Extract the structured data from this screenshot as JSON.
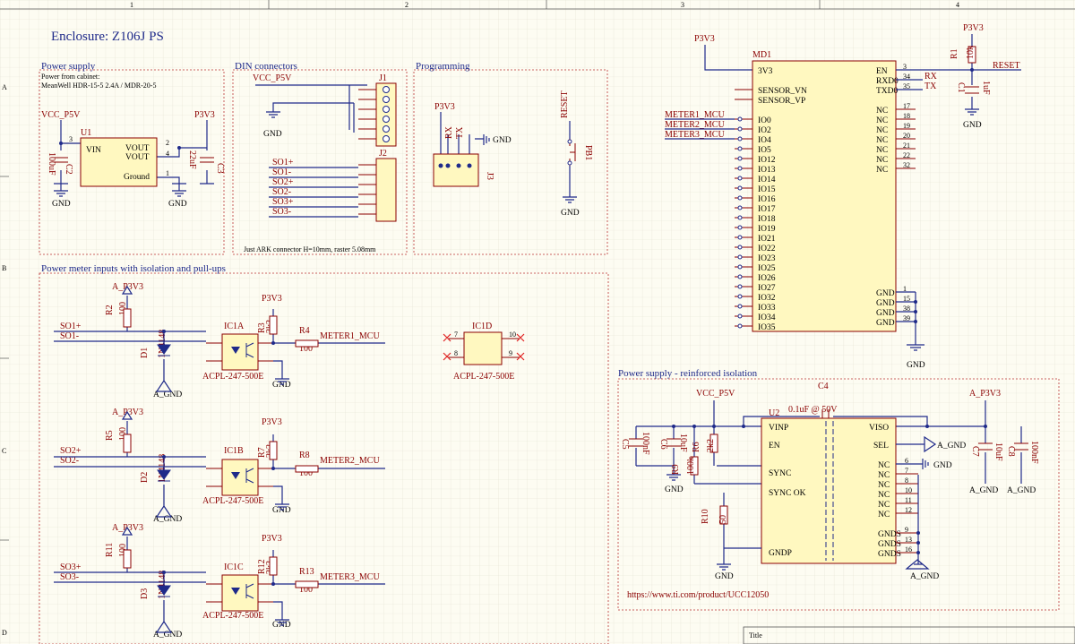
{
  "title": "Enclosure: Z106J PS",
  "grid": {
    "columns": [
      "1",
      "2",
      "3",
      "4"
    ],
    "rows": [
      "A",
      "B",
      "C",
      "D"
    ]
  },
  "sections": {
    "power_supply": "Power supply",
    "power_supply_note1": "Power from cabinet:",
    "power_supply_note2": "MeanWell HDR-15-5 2.4A / MDR-20-5",
    "din": "DIN connectors",
    "din_note": "Just ARK connector H=10mm, raster 5.08mm",
    "programming": "Programming",
    "meter_inputs": "Power meter inputs with isolation and pull-ups",
    "reinforced": "Power supply - reinforced isolation",
    "reinforced_url": "https://www.ti.com/product/UCC12050"
  },
  "nets": {
    "vcc": "VCC_P5V",
    "p3v3": "P3V3",
    "gnd": "GND",
    "a_p3v3": "A_P3V3",
    "a_gnd": "A_GND",
    "reset": "RESET",
    "rx": "RX",
    "tx": "TX",
    "so1p": "SO1+",
    "so1m": "SO1-",
    "so2p": "SO2+",
    "so2m": "SO2-",
    "so3p": "SO3+",
    "so3m": "SO3-",
    "meter1": "METER1_MCU",
    "meter2": "METER2_MCU",
    "meter3": "METER3_MCU"
  },
  "parts": {
    "u1": "U1",
    "u1_vin": "VIN",
    "u1_vout": "VOUT",
    "u1_gnd": "Ground",
    "c2": "C2",
    "c2_val": "100uF",
    "c3": "C3",
    "c3_val": "22uF",
    "j1": "J1",
    "j2": "J2",
    "j3": "J3",
    "pb1": "PB1",
    "md1": "MD1",
    "md1_left": [
      "3V3",
      "SENSOR_VN",
      "SENSOR_VP",
      "IO0",
      "IO2",
      "IO4",
      "IO5",
      "IO12",
      "IO13",
      "IO14",
      "IO15",
      "IO16",
      "IO17",
      "IO18",
      "IO19",
      "IO21",
      "IO22",
      "IO23",
      "IO25",
      "IO26",
      "IO27",
      "IO32",
      "IO33",
      "IO34",
      "IO35"
    ],
    "md1_right": [
      "EN",
      "RXD0",
      "TXD0",
      "NC",
      "NC",
      "NC",
      "NC",
      "NC",
      "NC",
      "NC",
      "GND",
      "GND",
      "GND",
      "GND"
    ],
    "md1_right_pins": [
      "3",
      "34",
      "35",
      "17",
      "18",
      "19",
      "20",
      "21",
      "22",
      "32",
      "1",
      "15",
      "38",
      "39"
    ],
    "r1": "R1",
    "r1_val": "10k",
    "c1": "C1",
    "c1_val": "1uF",
    "r2": "R2",
    "r2_val": "100",
    "r3": "R3",
    "r3_val": "2k2",
    "r4": "R4",
    "r4_val": "100",
    "d1": "D1",
    "d1_val": "1N4148",
    "ic1a": "IC1A",
    "ic1b": "IC1B",
    "ic1c": "IC1C",
    "ic1d": "IC1D",
    "ic_val": "ACPL-247-500E",
    "r5": "R5",
    "r5_val": "100",
    "r7": "R7",
    "r7_val": "2k2",
    "r8": "R8",
    "r8_val": "100",
    "d2": "D2",
    "d2_val": "1N4148",
    "r11": "R11",
    "r11_val": "100",
    "r12": "R12",
    "r12_val": "2k2",
    "r13": "R13",
    "r13_val": "100",
    "d3": "D3",
    "d3_val": "1N4148",
    "u2": "U2",
    "u2_vinp": "VINP",
    "u2_en": "EN",
    "u2_sync": "SYNC",
    "u2_syncok": "SYNC OK",
    "u2_gndp": "GNDP",
    "u2_viso": "VISO",
    "u2_sel": "SEL",
    "u2_right_labels": [
      "NC",
      "NC",
      "NC",
      "NC",
      "NC",
      "NC",
      "GNDS",
      "GNDS",
      "GNDS"
    ],
    "u2_right_pins": [
      "6",
      "7",
      "8",
      "10",
      "11",
      "12",
      "9",
      "13",
      "16"
    ],
    "c4": "C4",
    "c4_val": "0.1uF @ 50V",
    "c5": "C5",
    "c5_val": "100nF",
    "c6": "C6",
    "c6_val": "10uF",
    "r6": "R6",
    "r6_val": "2k2",
    "r9": "R9",
    "r9_val": "100k",
    "r10": "R10",
    "r10_val": "50",
    "c7": "C7",
    "c7_val": "10uF",
    "c8": "C8",
    "c8_val": "100nF"
  },
  "title_block": "Title"
}
